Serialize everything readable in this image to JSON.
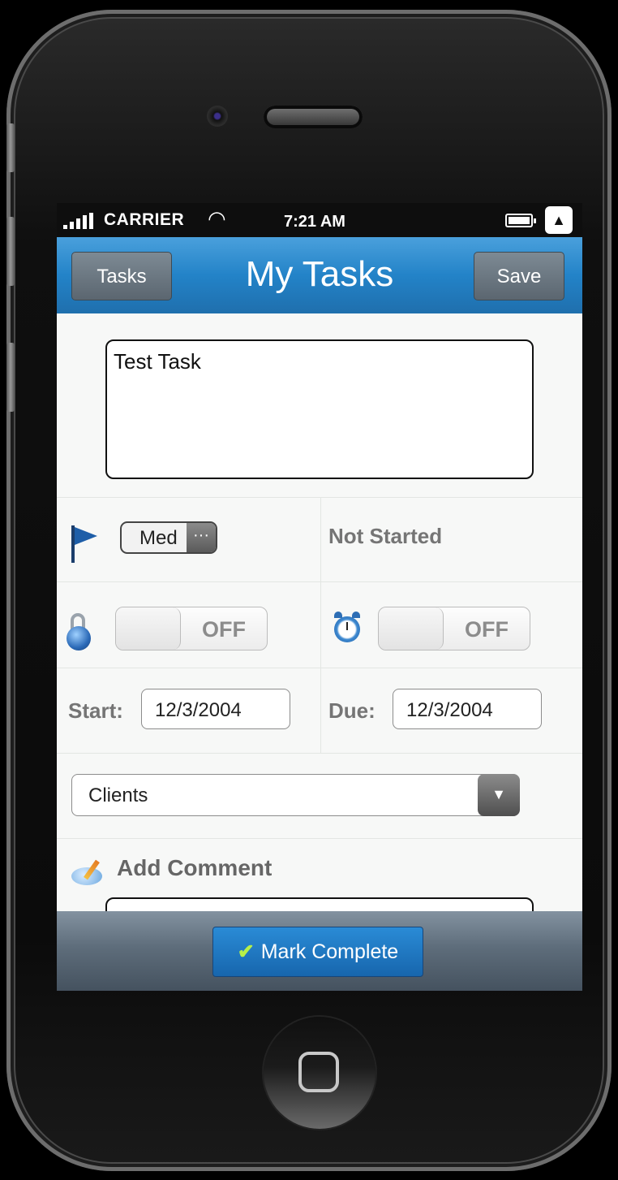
{
  "statusbar": {
    "carrier": "CARRIER",
    "time": "7:21 AM",
    "battery_level": 0.9
  },
  "navbar": {
    "back_label": "Tasks",
    "title": "My Tasks",
    "save_label": "Save"
  },
  "task": {
    "name": "Test Task"
  },
  "priority": {
    "value": "Med",
    "more": "···"
  },
  "status": {
    "text": "Not Started"
  },
  "private_toggle": {
    "state": "OFF"
  },
  "reminder_toggle": {
    "state": "OFF"
  },
  "dates": {
    "start_label": "Start:",
    "start_value": "12/3/2004",
    "due_label": "Due:",
    "due_value": "12/3/2004"
  },
  "category": {
    "selected": "Clients",
    "arrow": "▼"
  },
  "comment": {
    "label": "Add Comment"
  },
  "toolbar": {
    "check": "✔",
    "mark_complete_label": "Mark Complete"
  },
  "icons": [
    "signal-icon",
    "wifi-icon",
    "battery-icon",
    "arrow-up-icon",
    "flag-icon",
    "lock-icon",
    "alarm-clock-icon",
    "comment-icon",
    "check-icon"
  ],
  "colors": {
    "navbar_blue": "#2383c8",
    "button_blue": "#1f78c4",
    "toolbar_gray": "#5e6d7b",
    "check_green": "#b6f04a"
  }
}
